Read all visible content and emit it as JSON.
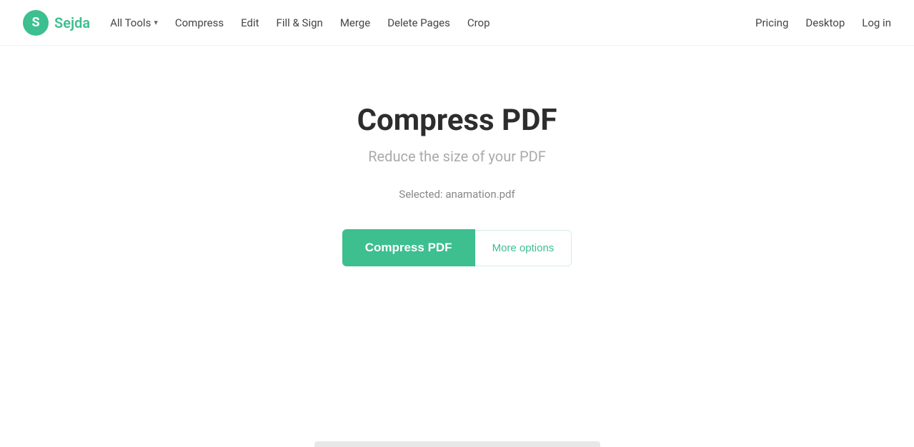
{
  "logo": {
    "icon_letter": "S",
    "text": "Sejda"
  },
  "nav": {
    "all_tools_label": "All Tools",
    "links": [
      {
        "label": "Compress",
        "id": "compress"
      },
      {
        "label": "Edit",
        "id": "edit"
      },
      {
        "label": "Fill & Sign",
        "id": "fill-sign"
      },
      {
        "label": "Merge",
        "id": "merge"
      },
      {
        "label": "Delete Pages",
        "id": "delete-pages"
      },
      {
        "label": "Crop",
        "id": "crop"
      }
    ],
    "right_links": [
      {
        "label": "Pricing",
        "id": "pricing"
      },
      {
        "label": "Desktop",
        "id": "desktop"
      },
      {
        "label": "Log in",
        "id": "login"
      }
    ]
  },
  "main": {
    "title": "Compress PDF",
    "subtitle": "Reduce the size of your PDF",
    "selected_file_label": "Selected:",
    "selected_file_name": "anamation.pdf",
    "compress_button_label": "Compress PDF",
    "more_options_label": "More options"
  }
}
